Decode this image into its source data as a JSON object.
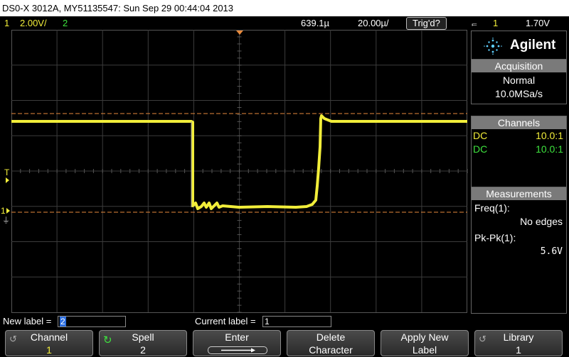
{
  "titlebar": {
    "text": "DS0-X 3012A, MY51135547: Sun Sep 29 00:44:04 2013"
  },
  "status": {
    "ch1_num": "1",
    "ch1_scale": "2.00V/",
    "ch2_num": "2",
    "h_pos": "639.1µ",
    "timebase": "20.00µ/",
    "trig_state": "Trig'd?",
    "trig_icon": "⫭",
    "trig_source": "1",
    "trig_level": "1.70V"
  },
  "panel": {
    "brand": "Agilent",
    "acquisition": {
      "title": "Acquisition",
      "mode": "Normal",
      "rate": "10.0MSa/s"
    },
    "channels": {
      "title": "Channels",
      "ch1": {
        "coupling": "DC",
        "probe": "10.0:1"
      },
      "ch2": {
        "coupling": "DC",
        "probe": "10.0:1"
      }
    },
    "measurements": {
      "title": "Measurements",
      "m1_label": "Freq(1):",
      "m1_value": "No edges",
      "m2_label": "Pk-Pk(1):",
      "m2_value": "5.6V"
    }
  },
  "labels": {
    "new_label": "New label =",
    "new_value": "2",
    "current_label": "Current label =",
    "current_value": "1"
  },
  "softkeys": [
    {
      "l1": "Channel",
      "l2": "1"
    },
    {
      "l1": "Spell",
      "l2": "2"
    },
    {
      "l1": "Enter",
      "l2": ""
    },
    {
      "l1": "Delete",
      "l2": "Character"
    },
    {
      "l1": "Apply New",
      "l2": "Label"
    },
    {
      "l1": "Library",
      "l2": "1"
    }
  ],
  "markers": {
    "trig_marker": "T",
    "ch1_marker": "1"
  },
  "colors": {
    "trace": "#f2ee3a",
    "ref_lines": "#e88a3c",
    "grid": "#3c3c3c",
    "ch2": "#3ee23e"
  }
}
